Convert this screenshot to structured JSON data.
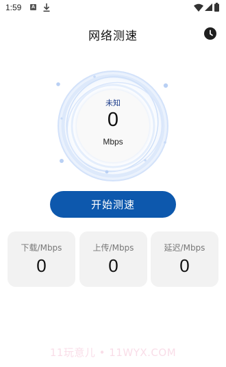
{
  "status_bar": {
    "time": "1:59",
    "left_icons": [
      "a-notification-icon",
      "download-icon"
    ],
    "right_icons": [
      "wifi-icon",
      "signal-icon",
      "battery-icon"
    ]
  },
  "header": {
    "title": "网络测速",
    "history_icon": "clock-icon"
  },
  "gauge": {
    "status": "未知",
    "value": "0",
    "unit": "Mbps",
    "ring_color": "#d8e6fb"
  },
  "start_button": {
    "label": "开始测速",
    "color": "#0d58ad"
  },
  "stats": [
    {
      "label": "下载/Mbps",
      "value": "0"
    },
    {
      "label": "上传/Mbps",
      "value": "0"
    },
    {
      "label": "延迟/Mbps",
      "value": "0"
    }
  ],
  "watermark": "11玩意儿 • 11WYX.COM"
}
